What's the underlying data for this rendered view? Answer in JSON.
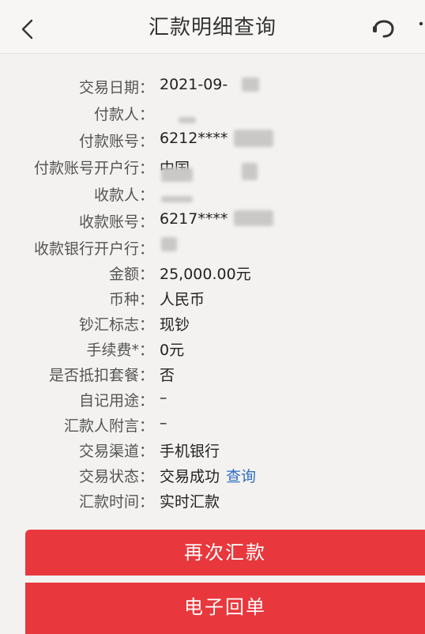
{
  "header": {
    "title": "汇款明细查询"
  },
  "details": [
    {
      "label": "交易日期",
      "value": "2021-09-"
    },
    {
      "label": "付款人",
      "value": ""
    },
    {
      "label": "付款账号",
      "value": "6212****"
    },
    {
      "label": "付款账号开户行",
      "value": "中国"
    },
    {
      "label": "收款人",
      "value": ""
    },
    {
      "label": "收款账号",
      "value": "6217****"
    },
    {
      "label": "收款银行开户行",
      "value": ""
    },
    {
      "label": "金额",
      "value": "25,000.00元"
    },
    {
      "label": "币种",
      "value": "人民币"
    },
    {
      "label": "钞汇标志",
      "value": "现钞"
    },
    {
      "label": "手续费*",
      "value": "0元"
    },
    {
      "label": "是否抵扣套餐",
      "value": "否"
    },
    {
      "label": "自记用途",
      "value": "–"
    },
    {
      "label": "汇款人附言",
      "value": "–"
    },
    {
      "label": "交易渠道",
      "value": "手机银行"
    },
    {
      "label": "交易状态",
      "value": "交易成功",
      "link": "查询"
    },
    {
      "label": "汇款时间",
      "value": "实时汇款"
    }
  ],
  "colon": "：",
  "buttons": {
    "remit_again": "再次汇款",
    "e_receipt": "电子回单"
  },
  "colors": {
    "accent": "#e8383d",
    "link": "#2f6fc4"
  },
  "icons": {
    "back": "chevron-left-icon",
    "service": "headset-icon"
  }
}
